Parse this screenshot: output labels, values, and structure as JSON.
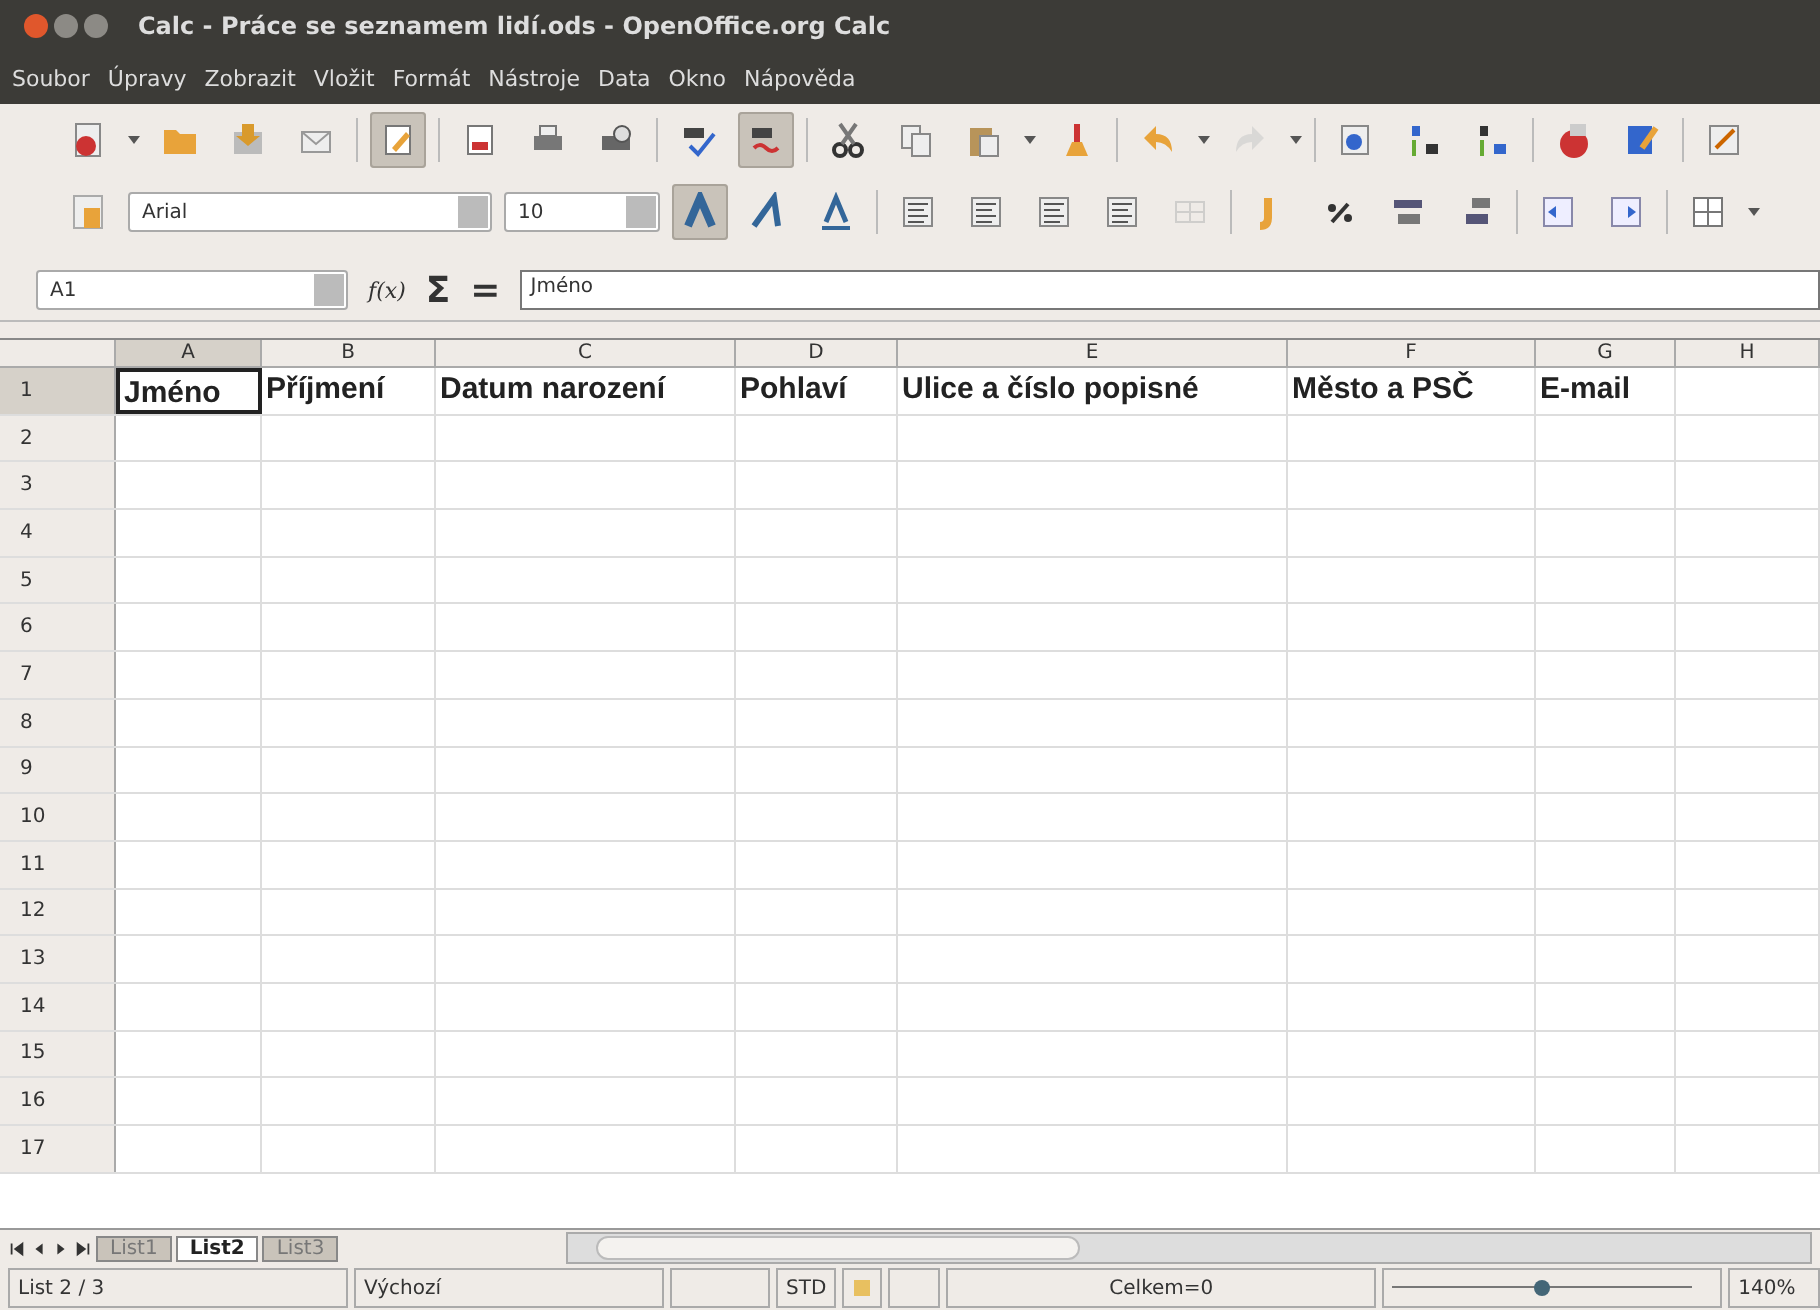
{
  "window": {
    "title": "Calc - Práce se seznamem lidí.ods - OpenOffice.org Calc"
  },
  "menu": [
    "Soubor",
    "Úpravy",
    "Zobrazit",
    "Vložit",
    "Formát",
    "Nástroje",
    "Data",
    "Okno",
    "Nápověda"
  ],
  "toolbar": {
    "edit_mode_on": true,
    "autospell_on": true
  },
  "formatting": {
    "font": "Arial",
    "size": "10",
    "bold_on": true
  },
  "formula_bar": {
    "name_box": "A1",
    "function_icon": "f(x)",
    "sum_symbol": "Σ",
    "equals_symbol": "=",
    "value": "Jméno"
  },
  "columns": [
    {
      "label": "A",
      "selected": true
    },
    {
      "label": "B",
      "selected": false
    },
    {
      "label": "C",
      "selected": false
    },
    {
      "label": "D",
      "selected": false
    },
    {
      "label": "E",
      "selected": false
    },
    {
      "label": "F",
      "selected": false
    },
    {
      "label": "G",
      "selected": false
    },
    {
      "label": "H",
      "selected": false
    }
  ],
  "rows": [
    {
      "number": "1",
      "selected": true,
      "cells": [
        "Jméno",
        "Příjmení",
        "Datum narození",
        "Pohlaví",
        "Ulice a číslo popisné",
        "Město a PSČ",
        "E-mail"
      ]
    },
    {
      "number": "2",
      "selected": false
    },
    {
      "number": "3",
      "selected": false
    },
    {
      "number": "4",
      "selected": false
    },
    {
      "number": "5",
      "selected": false
    },
    {
      "number": "6",
      "selected": false
    },
    {
      "number": "7",
      "selected": false
    },
    {
      "number": "8",
      "selected": false
    },
    {
      "number": "9",
      "selected": false
    },
    {
      "number": "10",
      "selected": false
    },
    {
      "number": "11",
      "selected": false
    },
    {
      "number": "12",
      "selected": false
    },
    {
      "number": "13",
      "selected": false
    },
    {
      "number": "14",
      "selected": false
    },
    {
      "number": "15",
      "selected": false
    },
    {
      "number": "16",
      "selected": false
    },
    {
      "number": "17",
      "selected": false
    }
  ],
  "sheet_tabs": [
    {
      "label": "List1",
      "selected": false
    },
    {
      "label": "List2",
      "selected": true
    },
    {
      "label": "List3",
      "selected": false
    }
  ],
  "status_bar": {
    "sheet": "List 2 / 3",
    "style": "Výchozí",
    "mode": "STD",
    "sum": "Celkem=0",
    "zoom": "140%",
    "zoom_slider": {
      "level": 0.5
    }
  }
}
